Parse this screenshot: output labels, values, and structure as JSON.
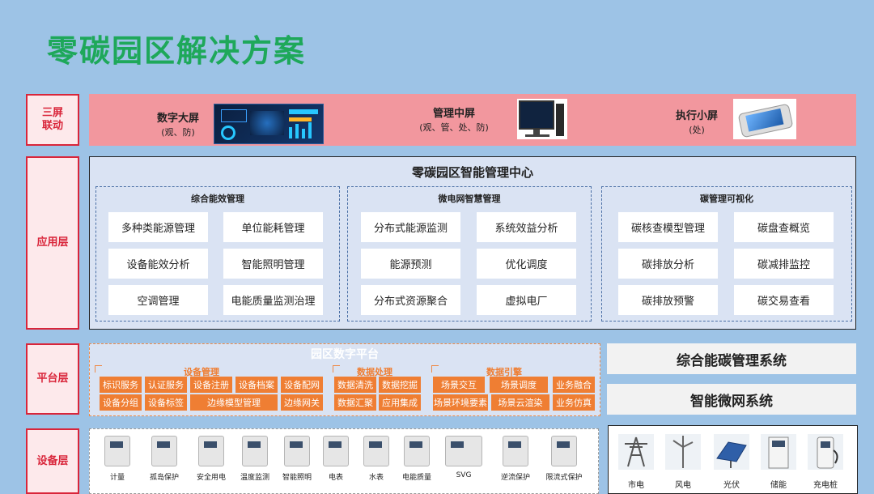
{
  "title": "零碳园区解决方案",
  "layers": {
    "screens": "三屏\n联动",
    "app": "应用层",
    "platform": "平台层",
    "device": "设备层"
  },
  "screens": [
    {
      "title": "数字大屏",
      "sub": "(观、防)"
    },
    {
      "title": "管理中屏",
      "sub": "(观、管、处、防)"
    },
    {
      "title": "执行小屏",
      "sub": "(处)"
    }
  ],
  "app": {
    "title": "零碳园区智能管理中心",
    "groups": [
      {
        "title": "综合能效管理",
        "items": [
          "多种类能源管理",
          "单位能耗管理",
          "设备能效分析",
          "智能照明管理",
          "空调管理",
          "电能质量监测治理"
        ]
      },
      {
        "title": "微电网智慧管理",
        "items": [
          "分布式能源监测",
          "系统效益分析",
          "能源预测",
          "优化调度",
          "分布式资源聚合",
          "虚拟电厂"
        ]
      },
      {
        "title": "碳管理可视化",
        "items": [
          "碳核查模型管理",
          "碳盘查概览",
          "碳排放分析",
          "碳减排监控",
          "碳排放预警",
          "碳交易查看"
        ]
      }
    ]
  },
  "platform": {
    "title": "园区数字平台",
    "device_mgmt": {
      "title": "设备管理",
      "items": [
        "标识服务",
        "认证服务",
        "设备注册",
        "设备档案",
        "设备配网",
        "设备分组",
        "设备标签",
        "边缘模型管理",
        "边缘网关"
      ]
    },
    "data_proc": {
      "title": "数据处理",
      "items": [
        "数据清洗",
        "数据挖掘",
        "数据汇聚",
        "应用集成"
      ]
    },
    "data_engine": {
      "title": "数据引擎",
      "items": [
        "场景交互",
        "场景调度",
        "业务融合",
        "场景环境要素",
        "场景云渲染",
        "业务仿真"
      ]
    }
  },
  "systems": [
    "综合能碳管理系统",
    "智能微网系统"
  ],
  "devices": [
    "计量",
    "孤岛保护",
    "安全用电",
    "温度监测",
    "智能照明",
    "电表",
    "水表",
    "电能质量",
    "SVG",
    "逆流保护",
    "限流式保护"
  ],
  "energy": [
    "市电",
    "风电",
    "光伏",
    "储能",
    "充电桩"
  ]
}
